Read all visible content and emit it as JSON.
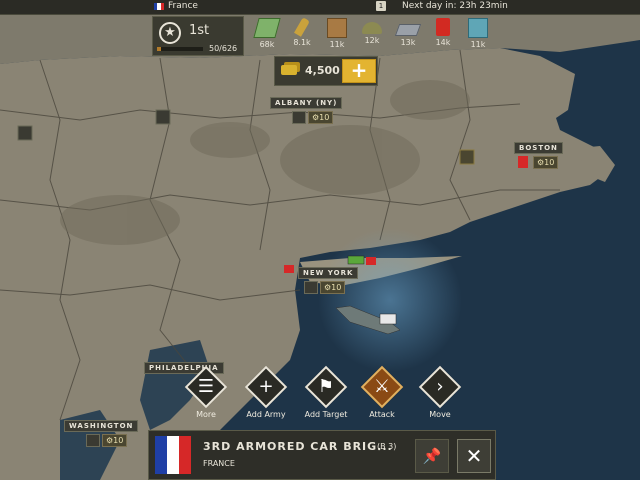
{
  "top_bar": {
    "country": "France",
    "calendar_day": "1",
    "next_day": "Next day in: 23h 23min"
  },
  "rank": {
    "position": "1st",
    "progress_text": "50/626",
    "progress_fraction": 0.08
  },
  "resources": [
    {
      "icon": "money-icon",
      "value": "68k"
    },
    {
      "icon": "ammo-icon",
      "value": "8.1k"
    },
    {
      "icon": "supplies-crate-icon",
      "value": "11k"
    },
    {
      "icon": "helmet-manpower-icon",
      "value": "12k"
    },
    {
      "icon": "steel-icon",
      "value": "13k"
    },
    {
      "icon": "fuel-canister-icon",
      "value": "14k"
    },
    {
      "icon": "components-icon",
      "value": "11k"
    }
  ],
  "gold": {
    "value": "4,500",
    "add_label": "+"
  },
  "cities": {
    "albany": {
      "name": "ALBANY (NY)",
      "level": "10"
    },
    "boston": {
      "name": "BOSTON",
      "level": "10"
    },
    "new_york": {
      "name": "NEW YORK",
      "level": "10"
    },
    "philadelphia": {
      "name": "PHILADELPHIA"
    },
    "washington": {
      "name": "WASHINGTON",
      "level": "10"
    }
  },
  "actions": [
    {
      "label": "More",
      "icon": "menu-icon"
    },
    {
      "label": "Add Army",
      "icon": "plus-icon"
    },
    {
      "label": "Add Target",
      "icon": "target-flag-icon"
    },
    {
      "label": "Attack",
      "icon": "attack-icon",
      "active": true
    },
    {
      "label": "Move",
      "icon": "move-chevron-icon"
    }
  ],
  "unit_panel": {
    "name": "3RD ARMORED CAR BRIG...",
    "code": "(B 3)",
    "country": "FRANCE",
    "pin_icon": "pin-icon",
    "close_icon": "close-icon"
  },
  "colors": {
    "france_blue": "#1f3fa6",
    "france_white": "#ffffff",
    "france_red": "#d62828",
    "land": "#8a8474",
    "sea": "#1e3448",
    "gold": "#e3b431",
    "attack_active": "#8a4a14"
  }
}
